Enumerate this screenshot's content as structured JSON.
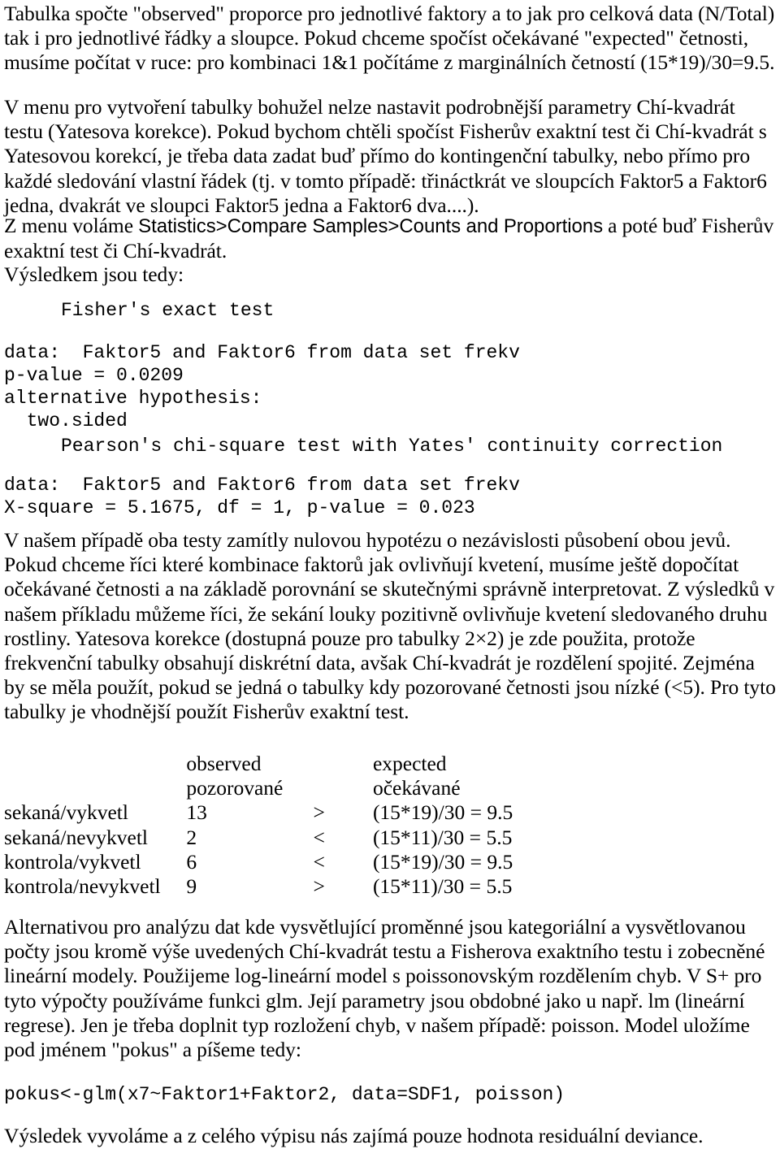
{
  "document": {
    "language": "cs",
    "text_color": "#000000",
    "background_color": "#ffffff"
  },
  "paragraphs": {
    "intro": "Tabulka spočte \"observed\" proporce pro jednotlivé faktory a to jak pro celková data (N/Total) tak i pro jednotlivé řádky a sloupce. Pokud chceme spočíst očekávané \"expected\" četnosti, musíme počítat v ruce: pro kombinaci 1&1 počítáme z marginálních četností (15*19)/30=9.5.",
    "menu_limits_part1": "V menu pro vytvoření tabulky bohužel nelze nastavit podrobnější parametry Chí-kvadrát testu (Yatesova korekce). Pokud bychom chtěli spočíst Fisherův exaktní test či Chí-kvadrát s Yatesovou korekcí, je třeba data zadat buď přímo do kontingenční tabulky, nebo přímo pro každé sledování vlastní řádek (tj. v tomto případě: třináctkrát ve sloupcích  Faktor5 a Faktor6 jedna, dvakrát ve sloupci Faktor5 jedna a Faktor6 dva....).",
    "menu_path_prefix": "Z menu voláme ",
    "menu_path": "Statistics>Compare Samples>Counts and Proportions",
    "menu_path_suffix": " a poté buď Fisherův exaktní test či Chí-kvadrát.",
    "result_intro": "Výsledkem jsou tedy:",
    "interpretation": "V našem případě oba testy zamítly nulovou hypotézu o nezávislosti působení obou jevů. Pokud chceme říci které kombinace faktorů jak ovlivňují kvetení, musíme ještě dopočítat očekávané četnosti a na základě porovnání se skutečnými správně interpretovat. Z výsledků v našem příkladu můžeme říci, že sekání louky pozitivně ovlivňuje kvetení sledovaného druhu rostliny. Yatesova korekce (dostupná pouze pro tabulky 2×2) je zde použita, protože frekvenční tabulky obsahují diskrétní data, avšak Chí-kvadrát je rozdělení spojité. Zejména by se měla použít, pokud se jedná o tabulky kdy pozorované četnosti jsou nízké (<5). Pro tyto tabulky je vhodnější použít Fisherův exaktní test.",
    "glm_intro": "Alternativou pro analýzu dat kde vysvětlující proměnné jsou kategoriální a vysvětlovanou počty jsou kromě výše uvedených Chí-kvadrát testu a Fisherova exaktního testu i zobecněné lineární modely. Použijeme log-lineární model s poissonovským rozdělením chyb. V S+ pro tyto výpočty používáme funkci glm. Její parametry jsou obdobné jako u např. lm (lineární regrese). Jen je třeba doplnit typ rozložení chyb, v našem případě: poisson. Model uložíme pod jménem \"pokus\" a píšeme tedy:",
    "closing": "Výsledek vyvoláme a z celého výpisu nás zajímá pouze hodnota residuální deviance."
  },
  "fisher_output": {
    "title": "Fisher's exact test",
    "lines": [
      "data:  Faktor5 and Faktor6 from data set frekv",
      "p-value = 0.0209",
      "alternative hypothesis:",
      "  two.sided"
    ]
  },
  "chisq_output": {
    "title": "Pearson's chi-square test with Yates' continuity correction",
    "lines": [
      "data:  Faktor5 and Faktor6 from data set frekv",
      "X-square = 5.1675, df = 1, p-value = 0.023"
    ]
  },
  "glm_code": "pokus<-glm(x7~Faktor1+Faktor2, data=SDF1, poisson)",
  "comparison_table": {
    "headers": {
      "label": "",
      "observed_en": "observed",
      "observed_cs": "pozorované",
      "expected_en": "expected",
      "expected_cs": "očekávané"
    },
    "rows": [
      {
        "label": "sekaná/vykvetl",
        "observed": "13",
        "operator": ">",
        "expected": "(15*19)/30 = 9.5"
      },
      {
        "label": "sekaná/nevykvetl",
        "observed": "2",
        "operator": "<",
        "expected": "(15*11)/30 = 5.5"
      },
      {
        "label": "kontrola/vykvetl",
        "observed": "6",
        "operator": "<",
        "expected": "(15*19)/30 = 9.5"
      },
      {
        "label": "kontrola/nevykvetl",
        "observed": "9",
        "operator": ">",
        "expected": "(15*11)/30 = 5.5"
      }
    ]
  }
}
